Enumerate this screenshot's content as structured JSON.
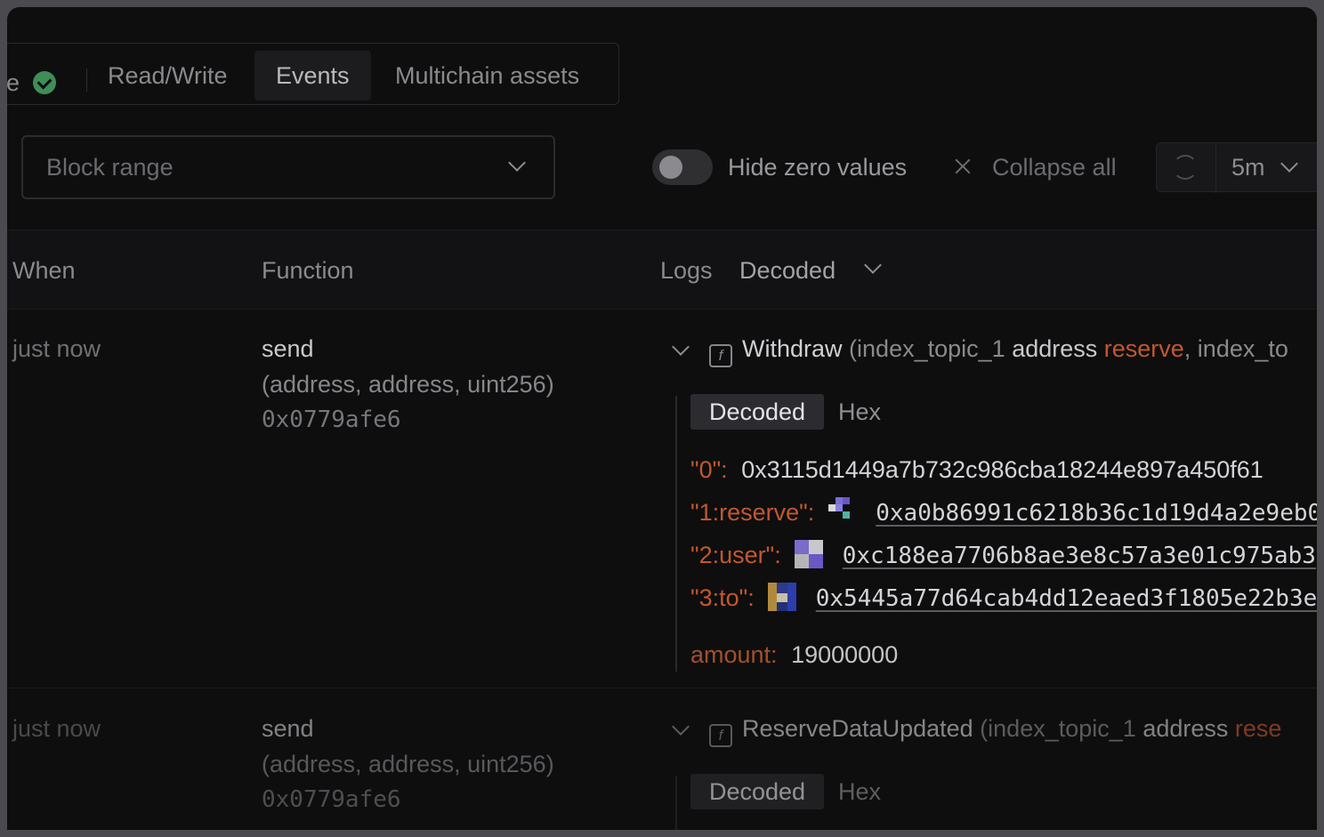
{
  "tabs": {
    "partial_label": "e",
    "items": [
      {
        "label": "Read/Write",
        "active": false
      },
      {
        "label": "Events",
        "active": true
      },
      {
        "label": "Multichain assets",
        "active": false
      }
    ]
  },
  "toolbar": {
    "block_range_placeholder": "Block range",
    "hide_zero_label": "Hide zero values",
    "hide_zero_enabled": false,
    "collapse_all_label": "Collapse all",
    "refresh_interval": "5m"
  },
  "table": {
    "headers": {
      "when": "When",
      "function": "Function",
      "logs": "Logs",
      "logs_mode": "Decoded"
    },
    "rows": [
      {
        "when": "just now",
        "function_name": "send",
        "function_args": "(address, address, uint256)",
        "function_selector": "0x0779afe6",
        "event_name": "Withdraw",
        "event_sig_open": "(index_topic_1",
        "event_sig_type": "address",
        "event_sig_param": "reserve",
        "event_sig_rest": ", index_to",
        "view_tabs": [
          "Decoded",
          "Hex"
        ],
        "fields": [
          {
            "key": "\"0\":",
            "value": "0x3115d1449a7b732c986cba18244e897a450f61"
          },
          {
            "key": "\"1:reserve\":",
            "value": "0xa0b86991c6218b36c1d19d4a2e9eb0"
          },
          {
            "key": "\"2:user\":",
            "value": "0xc188ea7706b8ae3e8c57a3e01c975ab3"
          },
          {
            "key": "\"3:to\":",
            "value": "0x5445a77d64cab4dd12eaed3f1805e22b3e"
          }
        ],
        "amount_key": "amount:",
        "amount_value": "19000000"
      },
      {
        "when": "just now",
        "function_name": "send",
        "function_args": "(address, address, uint256)",
        "function_selector": "0x0779afe6",
        "event_name": "ReserveDataUpdated",
        "event_sig_open": "(index_topic_1",
        "event_sig_type": "address",
        "event_sig_param": "rese",
        "view_tabs": [
          "Decoded",
          "Hex"
        ]
      }
    ]
  },
  "colors": {
    "accent_param": "#c2582e",
    "success": "#3f8e57",
    "background": "#0e0e0f"
  },
  "icons": [
    "check-circle-icon",
    "chevron-down-icon",
    "collapse-icon",
    "refresh-icon",
    "function-icon",
    "identicon"
  ]
}
